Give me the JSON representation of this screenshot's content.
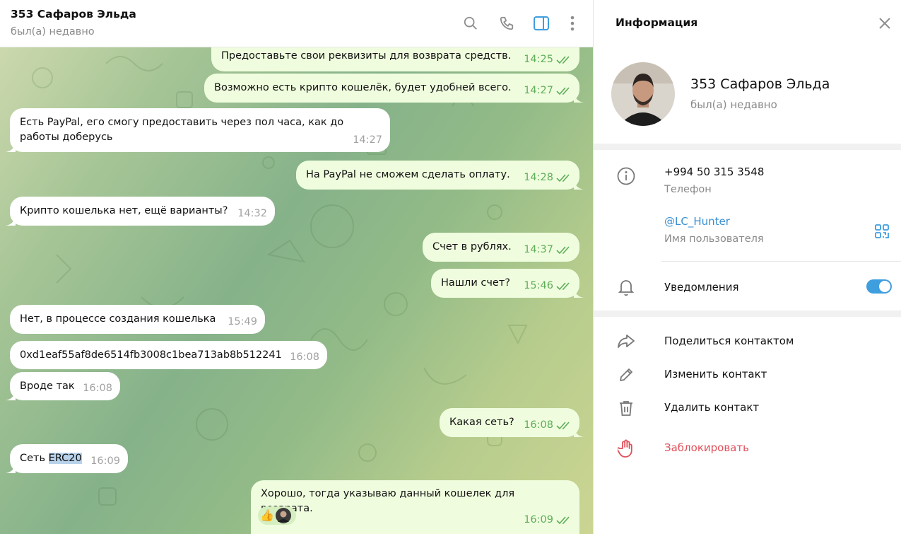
{
  "header": {
    "peer_name": "353 Сафаров Эльда",
    "peer_status": "был(а) недавно",
    "icons": [
      "search-icon",
      "phone-icon",
      "sidebar-toggle-icon",
      "more-vertical-icon"
    ]
  },
  "messages": [
    {
      "dir": "out",
      "text": "Предоставьте свои реквизиты для возврата средств.",
      "time": "14:25"
    },
    {
      "dir": "out",
      "text": "Возможно есть крипто кошелёк, будет удобней всего.",
      "time": "14:27"
    },
    {
      "dir": "in",
      "text": "Есть PayPal, его смогу предоставить через пол часа, как до работы доберусь",
      "time": "14:27"
    },
    {
      "dir": "out",
      "text": "На PayPal не сможем сделать оплату.",
      "time": "14:28"
    },
    {
      "dir": "in",
      "text": "Крипто кошелька нет, ещё варианты?",
      "time": "14:32"
    },
    {
      "dir": "out",
      "text": "Счет в рублях.",
      "time": "14:37"
    },
    {
      "dir": "out",
      "text": "Нашли счет?",
      "time": "15:46"
    },
    {
      "dir": "in",
      "text": "Нет, в процессе создания кошелька",
      "time": "15:49"
    },
    {
      "dir": "in",
      "text": "0xd1eaf55af8de6514fb3008c1bea713ab8b512241",
      "time": "16:08"
    },
    {
      "dir": "in",
      "text": "Вроде так",
      "time": "16:08"
    },
    {
      "dir": "out",
      "text": "Какая сеть?",
      "time": "16:08"
    },
    {
      "dir": "in",
      "text_prefix": "Сеть ",
      "text_highlight": "ERC20",
      "time": "16:09"
    },
    {
      "dir": "out",
      "text": "Хорошо, тогда указываю данный кошелек для возврата.",
      "time": "16:09",
      "reaction": "👍"
    }
  ],
  "panel": {
    "title": "Информация",
    "name": "353 Сафаров Эльда",
    "status": "был(а) недавно",
    "phone": "+994 50 315 3548",
    "phone_label": "Телефон",
    "username": "@LC_Hunter",
    "username_label": "Имя пользователя",
    "notifications_label": "Уведомления",
    "notifications_on": true,
    "actions": {
      "share": "Поделиться контактом",
      "edit": "Изменить контакт",
      "delete": "Удалить контакт",
      "block": "Заблокировать"
    }
  },
  "colors": {
    "accent": "#3f9ede",
    "out_bubble": "#effdde",
    "in_bubble": "#ffffff",
    "danger": "#e0505b",
    "check": "#5fad5a"
  }
}
